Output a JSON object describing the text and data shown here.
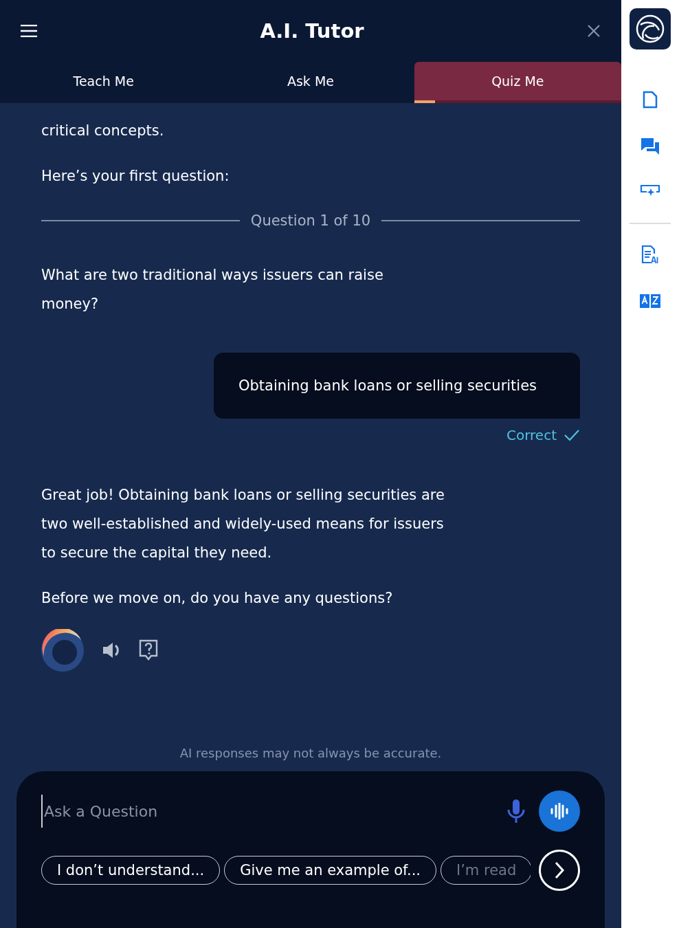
{
  "header": {
    "title": "A.I. Tutor"
  },
  "tabs": [
    {
      "label": "Teach Me",
      "selected": false
    },
    {
      "label": "Ask Me",
      "selected": false
    },
    {
      "label": "Quiz Me",
      "selected": true
    }
  ],
  "chat": {
    "intro_rest": "critical concepts.",
    "lead": "Here’s your first question:",
    "divider": "Question 1 of 10",
    "question": "What are two traditional ways issuers can raise money?",
    "answer": "Obtaining bank loans or selling securities",
    "verdict": "Correct",
    "correct": true,
    "feedback": [
      "Great job! Obtaining bank loans or selling securities are two well-established and widely-used means for issuers to secure the capital they need.",
      "Before we move on, do you have any questions?"
    ]
  },
  "disclaimer": "AI responses may not always be accurate.",
  "input": {
    "placeholder": "Ask a Question"
  },
  "suggestions": [
    "I don’t understand...",
    "Give me an example of...",
    "I’m read"
  ]
}
